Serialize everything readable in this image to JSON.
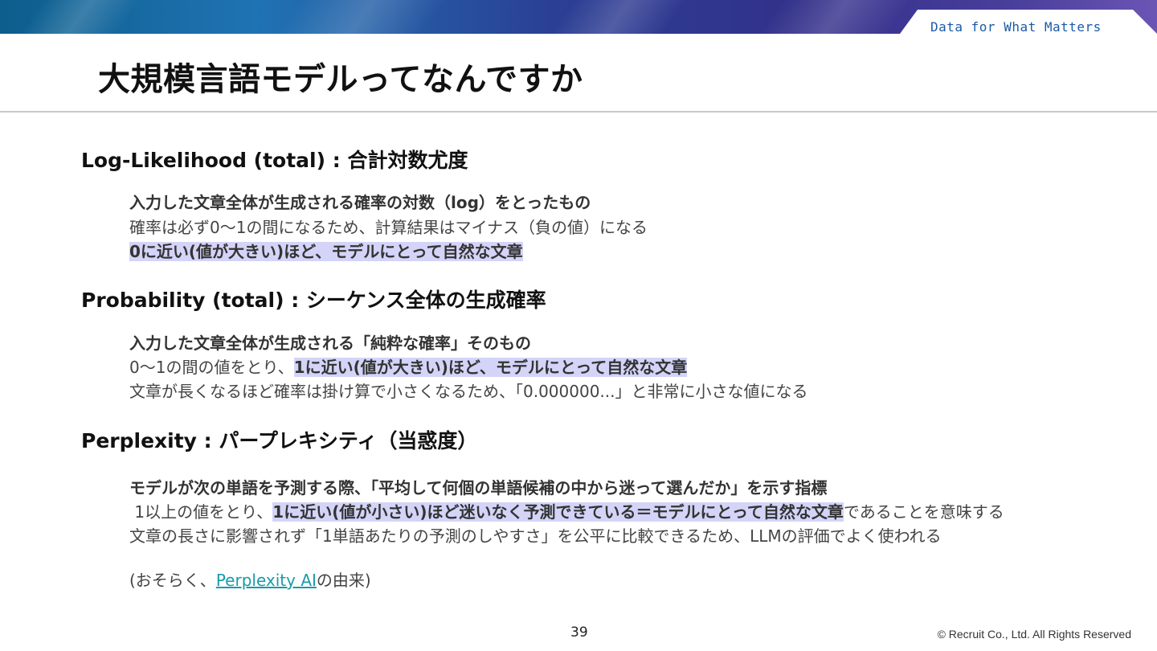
{
  "header": {
    "tagline": "Data for What Matters",
    "title": "大規模言語モデルってなんですか"
  },
  "sections": [
    {
      "heading": "Log-Likelihood (total) : 合計対数尤度",
      "lines": [
        "入力した文章全体が生成される確率の対数（log）をとったもの",
        "確率は必ず0〜1の間になるため、計算結果はマイナス（負の値）になる",
        "0に近い(値が大きい)ほど、モデルにとって自然な文章"
      ]
    },
    {
      "heading": "Probability (total) : シーケンス全体の生成確率",
      "lines": [
        "入力した文章全体が生成される「純粋な確率」そのもの",
        {
          "pre": "0〜1の間の値をとり、",
          "highlight": "1に近い(値が大きい)ほど、モデルにとって自然な文章"
        },
        "文章が長くなるほど確率は掛け算で小さくなるため、「0.000000...」と非常に小さな値になる"
      ]
    },
    {
      "heading": "Perplexity : パープレキシティ（当惑度）",
      "lines": [
        "モデルが次の単語を予測する際、「平均して何個の単語候補の中から迷って選んだか」を示す指標",
        {
          "pre": " 1以上の値をとり、",
          "highlight": "1に近い(値が小さい)ほど迷いなく予測できている＝モデルにとって自然な文章",
          "post": "であることを意味する"
        },
        "文章の長さに影響されず「1単語あたりの予測のしやすさ」を公平に比較できるため、LLMの評価でよく使われる"
      ],
      "note": {
        "pre": "(おそらく、",
        "link": "Perplexity AI",
        "post": "の由来)"
      }
    }
  ],
  "footer": {
    "page_number": "39",
    "copyright": "© Recruit Co., Ltd. All Rights Reserved"
  },
  "colors": {
    "highlight": "#d3d4f7",
    "link": "#1a9aa8",
    "tagline": "#1b5aa8"
  }
}
